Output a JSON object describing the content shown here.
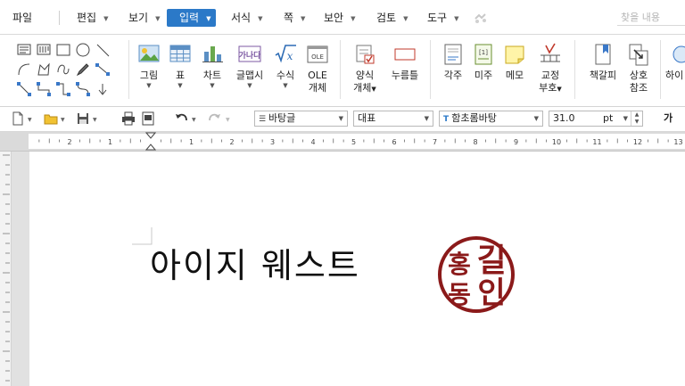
{
  "menu": {
    "items": [
      {
        "label": "파일",
        "dropdown": false
      },
      {
        "label": "편집",
        "dropdown": true
      },
      {
        "label": "보기",
        "dropdown": true
      },
      {
        "label": "입력",
        "dropdown": true,
        "active": true
      },
      {
        "label": "서식",
        "dropdown": true
      },
      {
        "label": "쪽",
        "dropdown": true
      },
      {
        "label": "보안",
        "dropdown": true
      },
      {
        "label": "검토",
        "dropdown": true
      },
      {
        "label": "도구",
        "dropdown": true
      }
    ],
    "search_placeholder": "찾을 내용"
  },
  "ribbon": {
    "groups": [
      {
        "label": "그림"
      },
      {
        "label": "표"
      },
      {
        "label": "차트"
      },
      {
        "label": "글맵시"
      },
      {
        "label": "수식"
      },
      {
        "label": "OLE 개체",
        "line1": "OLE",
        "line2": "개체"
      },
      {
        "label": "양식 개체",
        "line1": "양식",
        "line2": "개체"
      },
      {
        "label": "누름틀"
      },
      {
        "label": "각주"
      },
      {
        "label": "미주"
      },
      {
        "label": "메모"
      },
      {
        "label": "교정 부호",
        "line1": "교정",
        "line2": "부호"
      },
      {
        "label": "책갈피"
      },
      {
        "label": "상호 참조",
        "line1": "상호",
        "line2": "참조"
      },
      {
        "label": "하이"
      }
    ],
    "icon_names": [
      "picture-icon",
      "table-icon",
      "chart-icon",
      "textart-icon",
      "formula-icon",
      "ole-object-icon",
      "form-object-icon",
      "field-icon",
      "footnote-icon",
      "endnote-icon",
      "memo-icon",
      "proofread-icon",
      "bookmark-icon",
      "cross-reference-icon"
    ]
  },
  "format_bar": {
    "style": "바탕글",
    "language": "대표",
    "font": "함초롬바탕",
    "size": "31.0",
    "unit": "pt",
    "bold_label": "가"
  },
  "ruler": {
    "ticks": [
      "2",
      "1",
      "1",
      "2",
      "3",
      "4",
      "5",
      "6",
      "7",
      "8",
      "9",
      "10",
      "11",
      "12",
      "13"
    ]
  },
  "document": {
    "text": "아이지 웨스트",
    "seal": {
      "chars": [
        "홍",
        "길",
        "동",
        "인"
      ],
      "color": "#8b1a1a"
    }
  },
  "colors": {
    "accent": "#2b79c8",
    "seal": "#8b1a1a"
  }
}
